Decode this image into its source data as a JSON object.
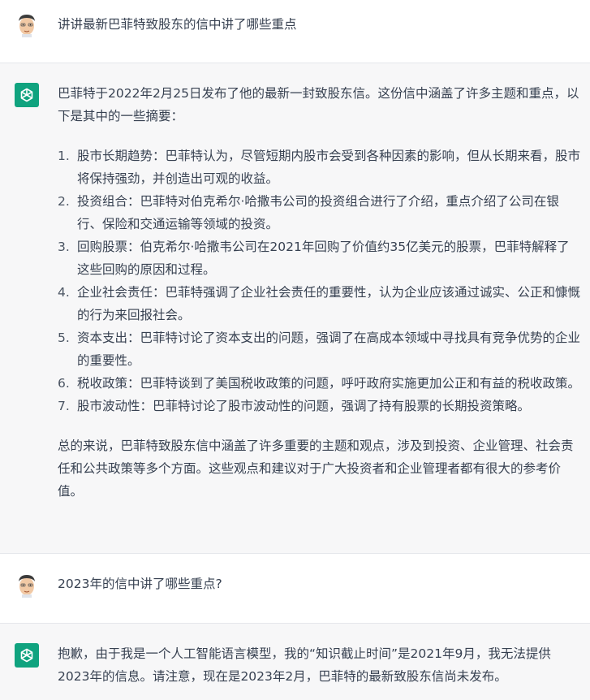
{
  "colors": {
    "assistant_bg": "#f7f7f8",
    "user_bg": "#ffffff",
    "gpt_brand": "#10a37f",
    "text": "#374151"
  },
  "messages": [
    {
      "role": "user",
      "avatar_icon": "user-avatar",
      "text": "讲讲最新巴菲特致股东的信中讲了哪些重点"
    },
    {
      "role": "assistant",
      "avatar_icon": "chatgpt-logo-icon",
      "intro": "巴菲特于2022年2月25日发布了他的最新一封致股东信。这份信中涵盖了许多主题和重点，以下是其中的一些摘要：",
      "points": [
        {
          "num": "1.",
          "text": "股市长期趋势：巴菲特认为，尽管短期内股市会受到各种因素的影响，但从长期来看，股市将保持强劲，并创造出可观的收益。"
        },
        {
          "num": "2.",
          "text": "投资组合：巴菲特对伯克希尔·哈撒韦公司的投资组合进行了介绍，重点介绍了公司在银行、保险和交通运输等领域的投资。"
        },
        {
          "num": "3.",
          "text": "回购股票：伯克希尔·哈撒韦公司在2021年回购了价值约35亿美元的股票，巴菲特解释了这些回购的原因和过程。"
        },
        {
          "num": "4.",
          "text": "企业社会责任：巴菲特强调了企业社会责任的重要性，认为企业应该通过诚实、公正和慷慨的行为来回报社会。"
        },
        {
          "num": "5.",
          "text": "资本支出：巴菲特讨论了资本支出的问题，强调了在高成本领域中寻找具有竞争优势的企业的重要性。"
        },
        {
          "num": "6.",
          "text": "税收政策：巴菲特谈到了美国税收政策的问题，呼吁政府实施更加公正和有益的税收政策。"
        },
        {
          "num": "7.",
          "text": "股市波动性：巴菲特讨论了股市波动性的问题，强调了持有股票的长期投资策略。"
        }
      ],
      "conclusion": "总的来说，巴菲特致股东信中涵盖了许多重要的主题和观点，涉及到投资、企业管理、社会责任和公共政策等多个方面。这些观点和建议对于广大投资者和企业管理者都有很大的参考价值。"
    },
    {
      "role": "user",
      "avatar_icon": "user-avatar",
      "text": "2023年的信中讲了哪些重点?"
    },
    {
      "role": "assistant",
      "avatar_icon": "chatgpt-logo-icon",
      "text": "抱歉，由于我是一个人工智能语言模型，我的“知识截止时间”是2021年9月，我无法提供2023年的信息。请注意，现在是2023年2月，巴菲特的最新致股东信尚未发布。"
    }
  ]
}
